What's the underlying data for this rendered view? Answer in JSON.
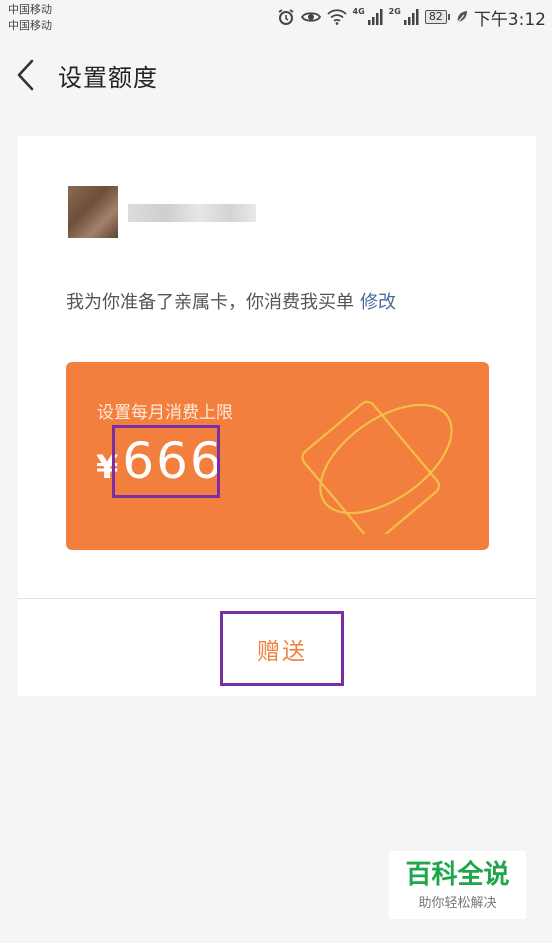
{
  "status_bar": {
    "carrier_1": "中国移动",
    "carrier_2": "中国移动",
    "net_1": "4G",
    "net_2": "2G",
    "battery": "82",
    "time": "下午3:12"
  },
  "header": {
    "title": "设置额度"
  },
  "card": {
    "message": "我为你准备了亲属卡，你消费我买单",
    "edit_link": "修改",
    "quota_label": "设置每月消费上限",
    "currency": "¥",
    "amount": "666",
    "gift_button": "赠送"
  },
  "watermark": {
    "title": "百科全说",
    "subtitle": "助你轻松解决"
  },
  "colors": {
    "accent": "#f37f3e",
    "link": "#4a6a9c",
    "highlight_box": "#7a2ea6"
  }
}
